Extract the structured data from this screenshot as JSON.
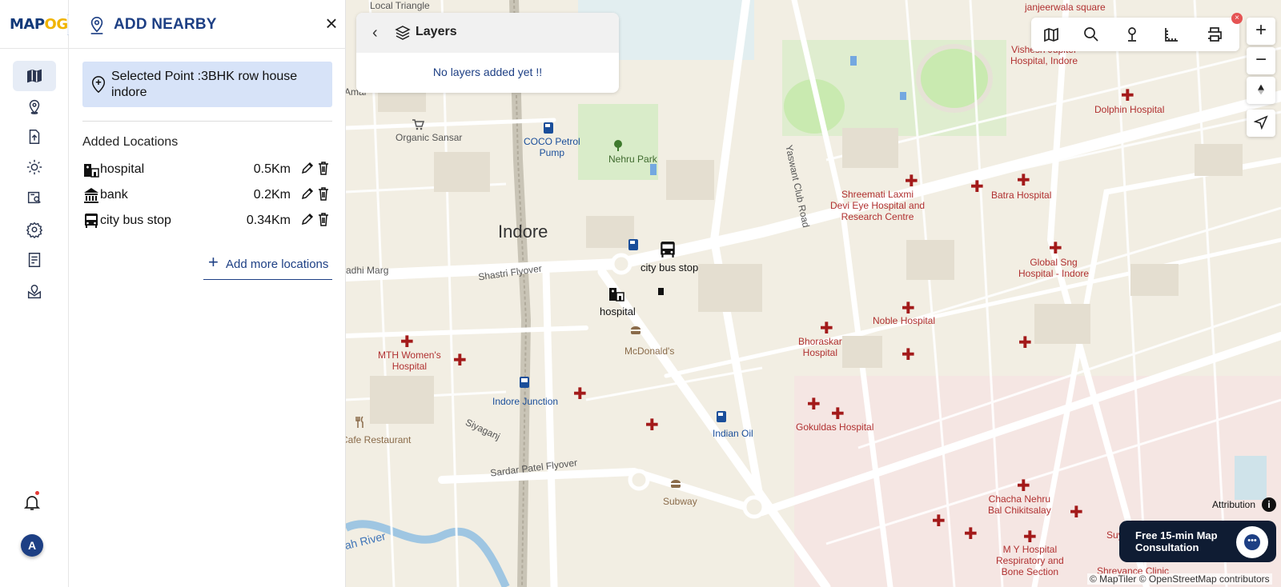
{
  "app": {
    "logo_text": "MAPOG",
    "logo_primary": "MAP",
    "logo_secondary": "OG",
    "expand_icon": "chevron-right-icon"
  },
  "rail": {
    "items": [
      {
        "icon": "map-icon",
        "active": true
      },
      {
        "icon": "location-pin-icon",
        "active": false
      },
      {
        "icon": "upload-file-icon",
        "active": false
      },
      {
        "icon": "gear-sun-icon",
        "active": false
      },
      {
        "icon": "map-analysis-icon",
        "active": false
      },
      {
        "icon": "settings-icon",
        "active": false
      },
      {
        "icon": "checklist-icon",
        "active": false
      },
      {
        "icon": "location-mail-icon",
        "active": false
      }
    ],
    "avatar_initial": "A"
  },
  "panel": {
    "title": "ADD NEARBY",
    "selected_point": "Selected Point :3BHK row house indore",
    "added_locations_title": "Added Locations",
    "locations": [
      {
        "name": "hospital",
        "distance": "0.5Km",
        "icon": "hospital-icon"
      },
      {
        "name": "bank",
        "distance": "0.2Km",
        "icon": "bank-icon"
      },
      {
        "name": "city bus stop",
        "distance": "0.34Km",
        "icon": "bus-icon"
      }
    ],
    "add_more_label": "Add more locations"
  },
  "layers": {
    "title": "Layers",
    "empty_message": "No layers added yet !!"
  },
  "map": {
    "city_label": "Indore",
    "labels": {
      "local_triangle": "Local Triangle",
      "janjeerwala": "janjeerwala square",
      "vishesh": "Vishesh Jupiter\nHospital, Indore",
      "dolphin": "Dolphin Hospital",
      "organic": "Organic Sansar",
      "coco": "COCO Petrol\nPump",
      "nehru": "Nehru Park",
      "yaswant": "Yaswant Club Road",
      "shreemati": "Shreemati Laxmi\nDevi Eye Hospital and\nResearch Centre",
      "batra": "Batra Hospital",
      "global": "Global Sng\nHospital - Indore",
      "noble": "Noble Hospital",
      "bhoraskar": "Bhoraskar\nHospital",
      "mth": "MTH Women's\nHospital",
      "mcd": "McDonald's",
      "indore_junction": "Indore Junction",
      "indian_oil": "Indian Oil",
      "gokuldas": "Gokuldas Hospital",
      "chacha": "Chacha Nehru\nBal Chikitsalay",
      "my_hospital": "M Y Hospital\nRespiratory and\nBone Section",
      "shreyance": "Shreyance Clinic",
      "suy": "Suy",
      "subway": "Subway",
      "cafe": "Cafe Restaurant",
      "sardar": "Sardar Patel Flyover",
      "siyaganj": "Siyaganj",
      "shastri": "Shastri Flyover",
      "adhi": "adhi Marg",
      "amar": "Amar",
      "river": "ah River",
      "marker_bus": "city bus stop",
      "marker_hospital": "hospital"
    },
    "attribution": "Attribution",
    "credits": "© MapTiler © OpenStreetMap contributors",
    "consult_text": "Free 15-min Map Consultation"
  },
  "toolbar": {
    "tools": [
      "map-layers-icon",
      "search-icon",
      "pin-icon",
      "measure-icon",
      "print-icon"
    ]
  },
  "zoom": {
    "in": "+",
    "out": "−"
  },
  "colors": {
    "brand": "#1d3f84",
    "brand_accent": "#f0b400",
    "selected_bg": "#d7e3f8",
    "hospital_marker": "#a31a1a"
  }
}
